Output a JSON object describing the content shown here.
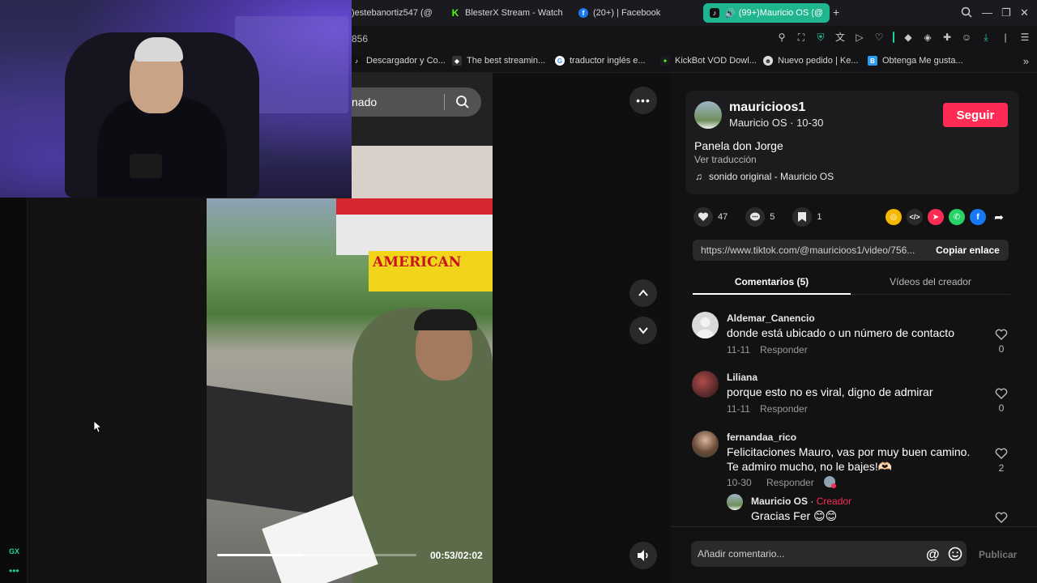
{
  "browser": {
    "tabs": [
      {
        "label": ")estebanortiz547 (@",
        "icon": "tiktok-icon",
        "active": false
      },
      {
        "label": "BlesterX Stream - Watch",
        "icon": "kick-icon",
        "active": false
      },
      {
        "label": "(20+) | Facebook",
        "icon": "facebook-icon",
        "active": false
      },
      {
        "label": "(99+)Mauricio OS (@",
        "icon": "tiktok-icon",
        "active": true
      }
    ],
    "url_fragment": "856",
    "bookmarks": [
      {
        "label": "Descargador y Co...",
        "icon": "tiktok-icon"
      },
      {
        "label": "The best streamin...",
        "icon": "diamond-icon"
      },
      {
        "label": "traductor inglés e...",
        "icon": "google-icon"
      },
      {
        "label": "KickBot VOD Dowl...",
        "icon": "kickbot-icon"
      },
      {
        "label": "Nuevo pedido | Ke...",
        "icon": "user-icon"
      },
      {
        "label": "Obtenga Me gusta...",
        "icon": "b-icon"
      }
    ],
    "sidebar_label": "GX",
    "accent": "#1fb58f"
  },
  "video": {
    "search_placeholder": "nado",
    "sign_text": "AMERICAN",
    "time": "00:53/02:02",
    "progress": 0.43
  },
  "post": {
    "username": "mauricioos1",
    "subname": "Mauricio OS · 10-30",
    "follow_label": "Seguir",
    "description": "Panela don Jorge",
    "translate_label": "Ver traducción",
    "sound": "sonido original - Mauricio OS",
    "likes": "47",
    "comments": "5",
    "saves": "1",
    "link": "https://www.tiktok.com/@mauricioos1/video/756...",
    "copy_label": "Copiar enlace",
    "tab_comments": "Comentarios (5)",
    "tab_videos": "Vídeos del creador",
    "brand_color": "#fe2c55"
  },
  "comments": [
    {
      "name": "Aldemar_Canencio",
      "text": "donde está ubicado o un número de contacto",
      "date": "11-11",
      "reply": "Responder",
      "likes": "0"
    },
    {
      "name": "Liliana",
      "text": "porque esto no es viral, digno de admirar",
      "date": "11-11",
      "reply": "Responder",
      "likes": "0"
    },
    {
      "name": "fernandaa_rico",
      "text": "Felicitaciones Mauro, vas por muy buen camino. Te admiro mucho, no le bajes!🫶🏻",
      "date": "10-30",
      "reply": "Responder",
      "likes": "2"
    }
  ],
  "reply": {
    "name": "Mauricio OS",
    "separator": " · ",
    "tag": "Creador",
    "text": "Gracias Fer 😊😊"
  },
  "composer": {
    "placeholder": "Añadir comentario...",
    "at_symbol": "@",
    "publish_label": "Publicar"
  }
}
